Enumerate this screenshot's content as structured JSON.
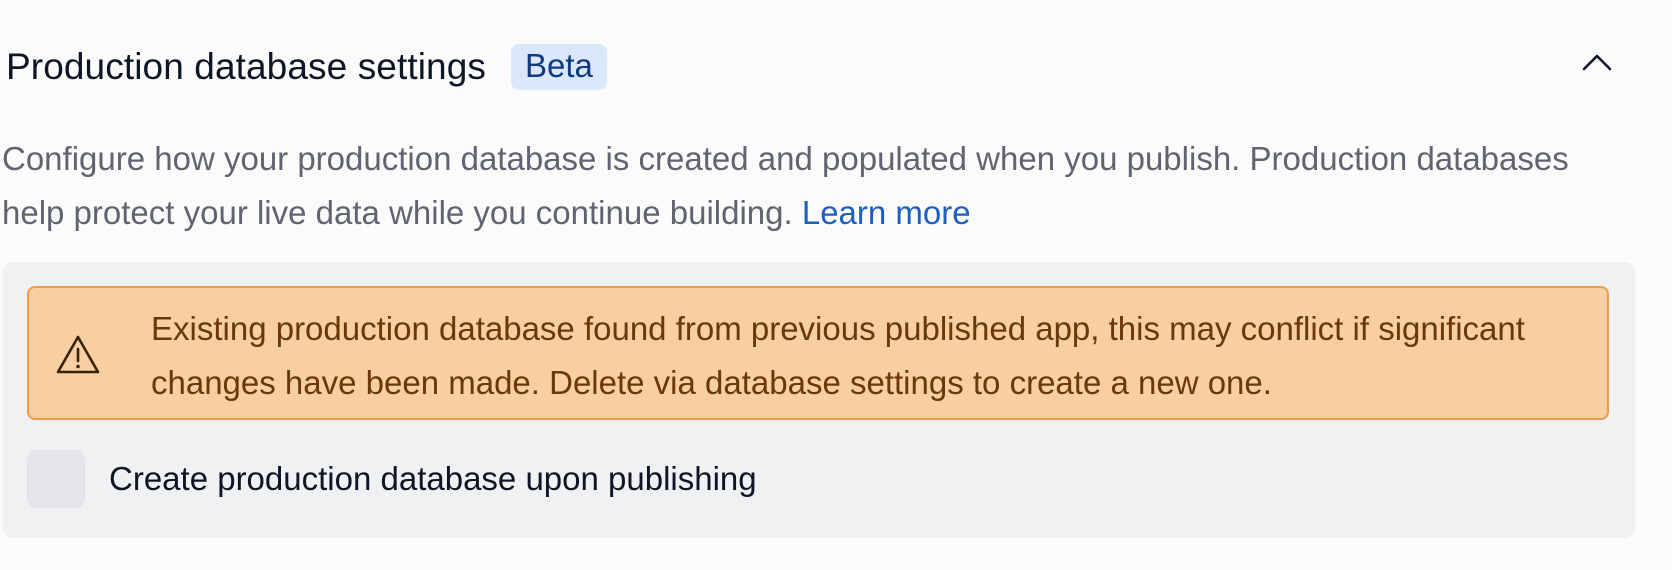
{
  "section": {
    "title": "Production database settings",
    "badge": "Beta",
    "collapse_icon": "chevron-up-icon",
    "description": "Configure how your production database is created and populated when you publish. Production databases help protect your live data while you continue building. ",
    "learn_more": "Learn more"
  },
  "warning": {
    "icon": "warning-triangle-icon",
    "text": "Existing production database found from previous published app, this may conflict if significant changes have been made. Delete via database settings to create a new one."
  },
  "option": {
    "label": "Create production database upon publishing",
    "checked": false
  },
  "colors": {
    "badge_bg": "#dbe8fb",
    "badge_text": "#0f3a80",
    "link": "#1d5fc0",
    "warning_bg": "#f8cfa0",
    "warning_border": "#ec9c4b",
    "warning_text": "#6b3908"
  }
}
